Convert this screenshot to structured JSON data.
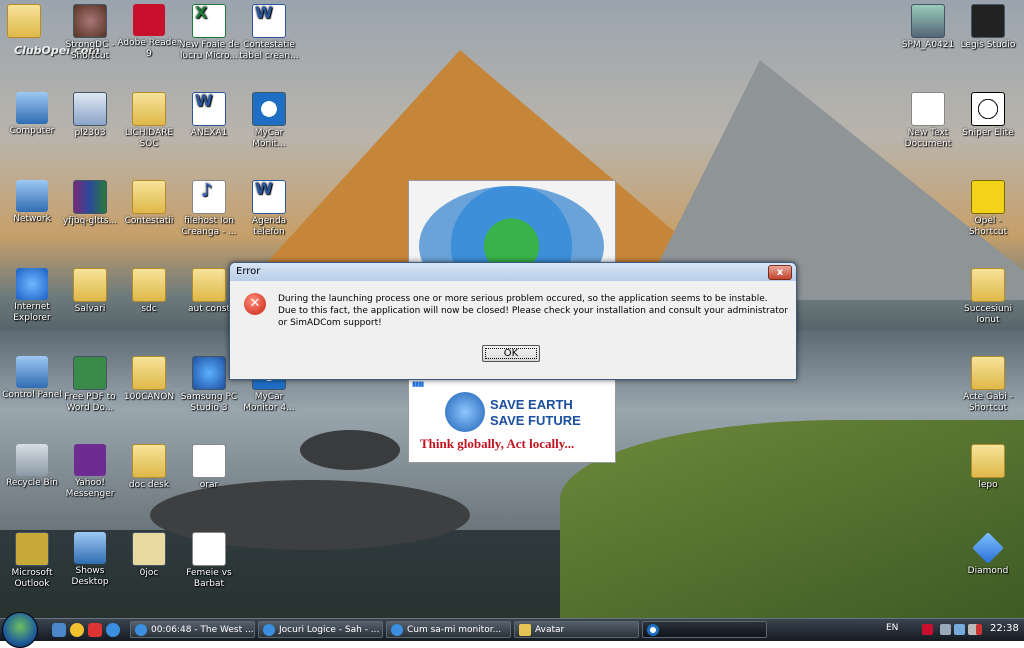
{
  "desktop": {
    "watermark": "ClubOpel.com",
    "icons": [
      {
        "label": "StrongDC - Shortcut"
      },
      {
        "label": "Adobe Reader 9"
      },
      {
        "label": "New Foaie de lucru Micro..."
      },
      {
        "label": "Contestatie tabel crean..."
      },
      {
        "label": "Computer"
      },
      {
        "label": "pl2303"
      },
      {
        "label": "LICHIDARE SOC"
      },
      {
        "label": "ANEXA1"
      },
      {
        "label": "MyCar Monit..."
      },
      {
        "label": "Network"
      },
      {
        "label": "yfjbq-gltts..."
      },
      {
        "label": "Contestatii"
      },
      {
        "label": "filehost Ion Creanga - ..."
      },
      {
        "label": "Agenda telefon"
      },
      {
        "label": "Internet Explorer"
      },
      {
        "label": "Salvari"
      },
      {
        "label": "sdc"
      },
      {
        "label": "aut const"
      },
      {
        "label": "Control Panel"
      },
      {
        "label": "Free PDF to Word Do..."
      },
      {
        "label": "100CANON"
      },
      {
        "label": "Samsung PC Studio 3"
      },
      {
        "label": "MyCar Monitor 4..."
      },
      {
        "label": "Recycle Bin"
      },
      {
        "label": "Yahoo! Messenger"
      },
      {
        "label": "doc desk"
      },
      {
        "label": "orar"
      },
      {
        "label": "Microsoft Outlook"
      },
      {
        "label": "Shows Desktop"
      },
      {
        "label": "0joc"
      },
      {
        "label": "Femeie vs Barbat"
      },
      {
        "label": "SPM_A0421"
      },
      {
        "label": "Legis Studio"
      },
      {
        "label": "New Text Document"
      },
      {
        "label": "Sniper Elite"
      },
      {
        "label": "Opel - Shortcut"
      },
      {
        "label": "Succesiuni Ionut"
      },
      {
        "label": "Acte Gabi - Shortcut"
      },
      {
        "label": "lepo"
      },
      {
        "label": "Diamond"
      }
    ]
  },
  "splash": {
    "progress": "▮▮▮▮",
    "save_line1": "SAVE EARTH",
    "save_line2": "SAVE FUTURE",
    "motto": "Think globally, Act locally..."
  },
  "dialog": {
    "title": "Error",
    "close": "x",
    "message": "During the launching process one or more serious problem occured, so the application seems to be instable. Due to this fact, the application will now be closed! Please check your installation and consult your administrator or SimADCom support!",
    "ok_label": "OK"
  },
  "taskbar": {
    "tasks": [
      {
        "label": "00:06:48 - The West ..."
      },
      {
        "label": "Jocuri Logice - Sah - ..."
      },
      {
        "label": "Cum sa-mi monitor..."
      },
      {
        "label": "Avatar"
      }
    ],
    "tray": {
      "lang": "EN",
      "clock": "22:38"
    }
  }
}
